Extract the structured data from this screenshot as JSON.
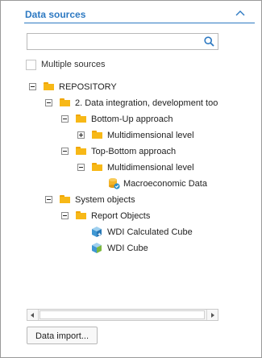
{
  "header": {
    "title": "Data sources",
    "collapse_icon": "chevron-up-icon",
    "accent_color": "#2d79c2"
  },
  "search": {
    "value": "",
    "placeholder": "",
    "icon": "search-icon"
  },
  "multiple_sources": {
    "label": "Multiple sources",
    "checked": false
  },
  "tree": {
    "nodes": [
      {
        "label": "REPOSITORY",
        "level": 0,
        "toggle": "minus",
        "icon": "folder-icon"
      },
      {
        "label": "2. Data integration, development too",
        "level": 1,
        "toggle": "minus",
        "icon": "folder-icon"
      },
      {
        "label": "Bottom-Up approach",
        "level": 2,
        "toggle": "minus",
        "icon": "folder-icon"
      },
      {
        "label": "Multidimensional level",
        "level": 3,
        "toggle": "plus",
        "icon": "folder-icon"
      },
      {
        "label": "Top-Bottom approach",
        "level": 2,
        "toggle": "minus",
        "icon": "folder-icon"
      },
      {
        "label": "Multidimensional level",
        "level": 3,
        "toggle": "minus",
        "icon": "folder-icon"
      },
      {
        "label": "Macroeconomic Data",
        "level": 4,
        "toggle": "none",
        "icon": "database-icon"
      },
      {
        "label": "System objects",
        "level": 0,
        "toggle": "minus",
        "icon": "folder-icon"
      },
      {
        "label": "Report Objects",
        "level": 1,
        "toggle": "minus",
        "icon": "folder-icon"
      },
      {
        "label": "WDI Calculated Cube",
        "level": 2,
        "toggle": "none",
        "icon": "calculated-cube-icon"
      },
      {
        "label": "WDI Cube",
        "level": 2,
        "toggle": "none",
        "icon": "cube-icon"
      }
    ]
  },
  "scrollbar": {
    "left_icon": "scroll-left-icon",
    "right_icon": "scroll-right-icon"
  },
  "footer": {
    "import_button": "Data import..."
  }
}
